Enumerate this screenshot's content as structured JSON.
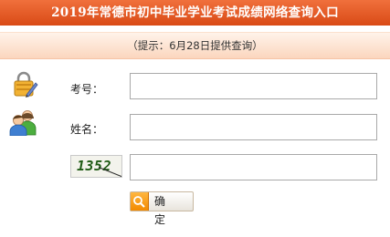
{
  "header": {
    "title": "2019年常德市初中毕业学业考试成绩网络查询入口"
  },
  "hint": {
    "text": "（提示：6月28日提供查询）"
  },
  "form": {
    "exam_label": "考号：",
    "exam_value": "",
    "name_label": "姓名：",
    "name_value": "",
    "captcha_image_text": "1352",
    "captcha_value": "",
    "submit_label": "确 定"
  },
  "icons": {
    "exam": "lock-pen-icon",
    "name": "users-icon",
    "submit": "search-icon"
  }
}
